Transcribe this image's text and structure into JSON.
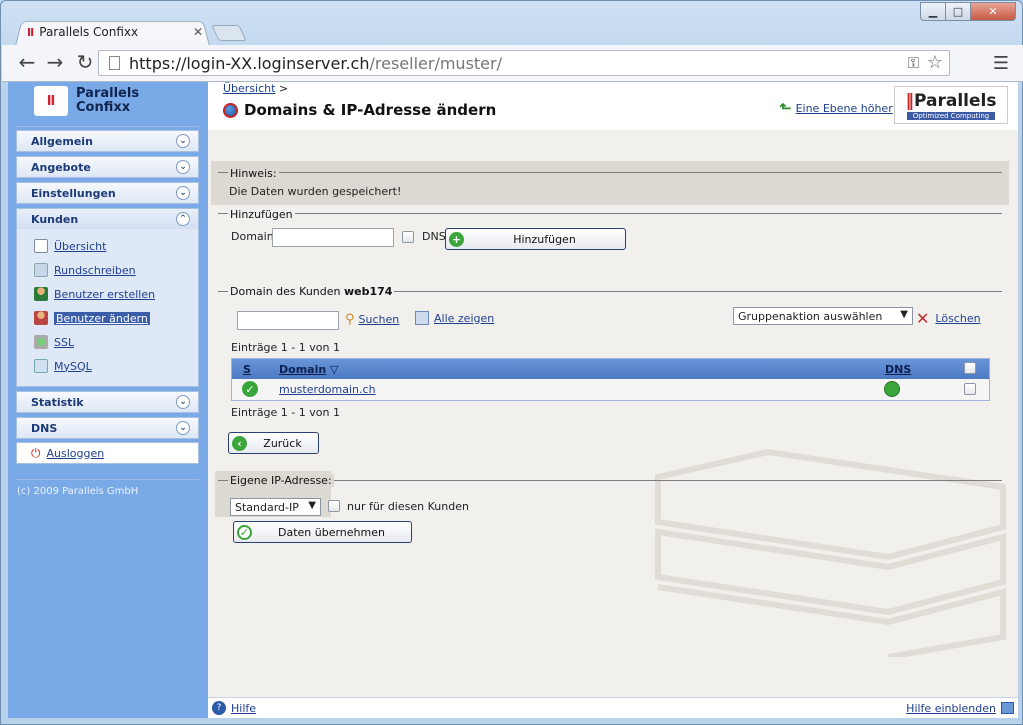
{
  "browser": {
    "tab_title": "Parallels Confixx",
    "url_host": "https://login-XX.loginserver.ch",
    "url_path": "/reseller/muster/"
  },
  "sidebar": {
    "logo_line1": "Parallels",
    "logo_line2": "Confixx",
    "menu": [
      {
        "label": "Allgemein"
      },
      {
        "label": "Angebote"
      },
      {
        "label": "Einstellungen"
      },
      {
        "label": "Kunden"
      },
      {
        "label": "Statistik"
      },
      {
        "label": "DNS"
      }
    ],
    "kunden_items": [
      {
        "label": "Übersicht"
      },
      {
        "label": "Rundschreiben"
      },
      {
        "label": "Benutzer erstellen"
      },
      {
        "label": "Benutzer ändern"
      },
      {
        "label": "SSL"
      },
      {
        "label": "MySQL"
      }
    ],
    "logout": "Ausloggen",
    "copyright": "(c) 2009 Parallels GmbH"
  },
  "header": {
    "breadcrumb": "Übersicht",
    "breadcrumb_sep": ">",
    "title": "Domains & IP-Adresse ändern",
    "up_link": "Eine Ebene höher",
    "brand": "Parallels",
    "brand_sub": "Optimized Computing"
  },
  "notice": {
    "legend": "Hinweis:",
    "message": "Die Daten wurden gespeichert!"
  },
  "add": {
    "legend": "Hinzufügen",
    "domain_label": "Domain",
    "domain_value": "",
    "dns_label": "DNS",
    "button": "Hinzufügen"
  },
  "customer": {
    "legend_prefix": "Domain des Kunden",
    "customer_id": "web174",
    "search_value": "",
    "search_link": "Suchen",
    "show_all_link": "Alle zeigen",
    "group_action": "Gruppenaktion auswählen",
    "delete_link": "Löschen",
    "entries_top": "Einträge 1 - 1 von 1",
    "entries_bottom": "Einträge 1 - 1 von 1",
    "columns": {
      "s": "S",
      "domain": "Domain",
      "sort_marker": "▽",
      "dns": "DNS"
    },
    "rows": [
      {
        "domain": "musterdomain.ch"
      }
    ],
    "back_button": "Zurück"
  },
  "ip": {
    "legend": "Eigene IP-Adresse:",
    "select_value": "Standard-IP",
    "only_customer_label": "nur für diesen Kunden",
    "apply_button": "Daten übernehmen"
  },
  "status": {
    "help": "Hilfe",
    "show_help": "Hilfe einblenden"
  },
  "colors": {
    "sidebar_bg": "#7aa9e8",
    "grid_header": "#5a86cf",
    "ok_green": "#3aa53a",
    "delete_red": "#c0282b"
  }
}
